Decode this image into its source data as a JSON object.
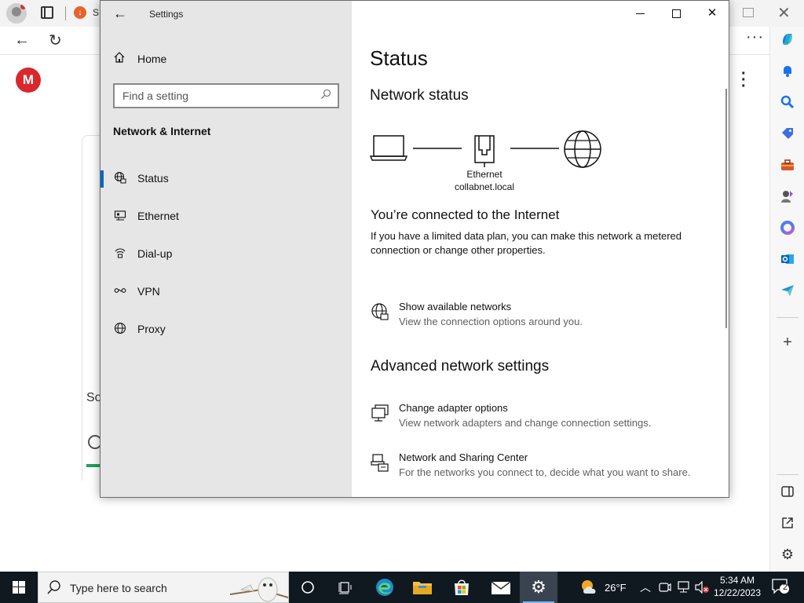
{
  "browser": {
    "tab_title": "S",
    "page_logo_letter": "M",
    "page_partial_text": "So"
  },
  "settings": {
    "window_title": "Settings",
    "home_label": "Home",
    "search_placeholder": "Find a setting",
    "section_title": "Network & Internet",
    "nav_items": [
      {
        "label": "Status",
        "icon": "status-globe-icon",
        "active": true
      },
      {
        "label": "Ethernet",
        "icon": "ethernet-icon",
        "active": false
      },
      {
        "label": "Dial-up",
        "icon": "dialup-icon",
        "active": false
      },
      {
        "label": "VPN",
        "icon": "vpn-icon",
        "active": false
      },
      {
        "label": "Proxy",
        "icon": "proxy-globe-icon",
        "active": false
      }
    ],
    "content": {
      "page_title": "Status",
      "network_status_heading": "Network status",
      "adapter_name": "Ethernet",
      "network_name": "collabnet.local",
      "connected_heading": "You’re connected to the Internet",
      "connected_desc": "If you have a limited data plan, you can make this network a metered connection or change other properties.",
      "show_networks_title": "Show available networks",
      "show_networks_desc": "View the connection options around you.",
      "advanced_heading": "Advanced network settings",
      "adapter_options_title": "Change adapter options",
      "adapter_options_desc": "View network adapters and change connection settings.",
      "sharing_center_title": "Network and Sharing Center",
      "sharing_center_desc": "For the networks you connect to, decide what you want to share."
    }
  },
  "taskbar": {
    "search_placeholder": "Type here to search",
    "weather_temp": "26°F",
    "time": "5:34 AM",
    "date": "12/22/2023",
    "notification_count": "2"
  },
  "colors": {
    "accent": "#0067c0",
    "settings_sidebar_bg": "#e6e6e6",
    "taskbar_bg": "#101820"
  }
}
